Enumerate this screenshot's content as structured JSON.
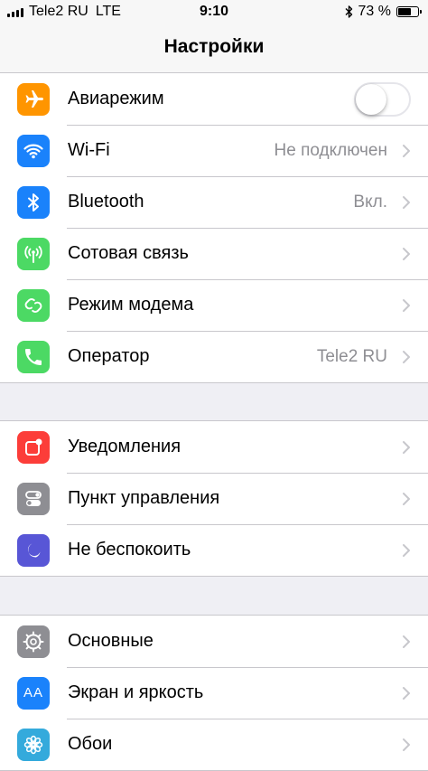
{
  "status_bar": {
    "carrier": "Tele2 RU",
    "network": "LTE",
    "time": "9:10",
    "battery_text": "73 %",
    "battery_level": 0.73
  },
  "nav": {
    "title": "Настройки"
  },
  "colors": {
    "airplane": "#ff9500",
    "wifi": "#1a82fb",
    "bluetooth": "#1a82fb",
    "cellular": "#4cd964",
    "hotspot": "#4cd964",
    "carrier": "#4cd964",
    "notifications": "#fc3d39",
    "control_center": "#8e8e93",
    "dnd": "#5856d6",
    "general": "#8e8e93",
    "display": "#1a82fb",
    "wallpaper": "#34aadc"
  },
  "groups": [
    {
      "rows": [
        {
          "label": "Авиарежим",
          "icon": "airplane-icon",
          "toggle_on": false
        },
        {
          "label": "Wi-Fi",
          "icon": "wifi-icon",
          "detail": "Не подключен"
        },
        {
          "label": "Bluetooth",
          "icon": "bluetooth-icon",
          "detail": "Вкл."
        },
        {
          "label": "Сотовая связь",
          "icon": "antenna-icon"
        },
        {
          "label": "Режим модема",
          "icon": "chain-link-icon"
        },
        {
          "label": "Оператор",
          "icon": "phone-icon",
          "detail": "Tele2 RU"
        }
      ]
    },
    {
      "rows": [
        {
          "label": "Уведомления",
          "icon": "notifications-icon"
        },
        {
          "label": "Пункт управления",
          "icon": "toggles-icon"
        },
        {
          "label": "Не беспокоить",
          "icon": "moon-icon"
        }
      ]
    },
    {
      "rows": [
        {
          "label": "Основные",
          "icon": "gear-icon"
        },
        {
          "label": "Экран и яркость",
          "icon": "text-size-icon",
          "icon_text": "AA"
        },
        {
          "label": "Обои",
          "icon": "flower-icon"
        }
      ]
    }
  ]
}
